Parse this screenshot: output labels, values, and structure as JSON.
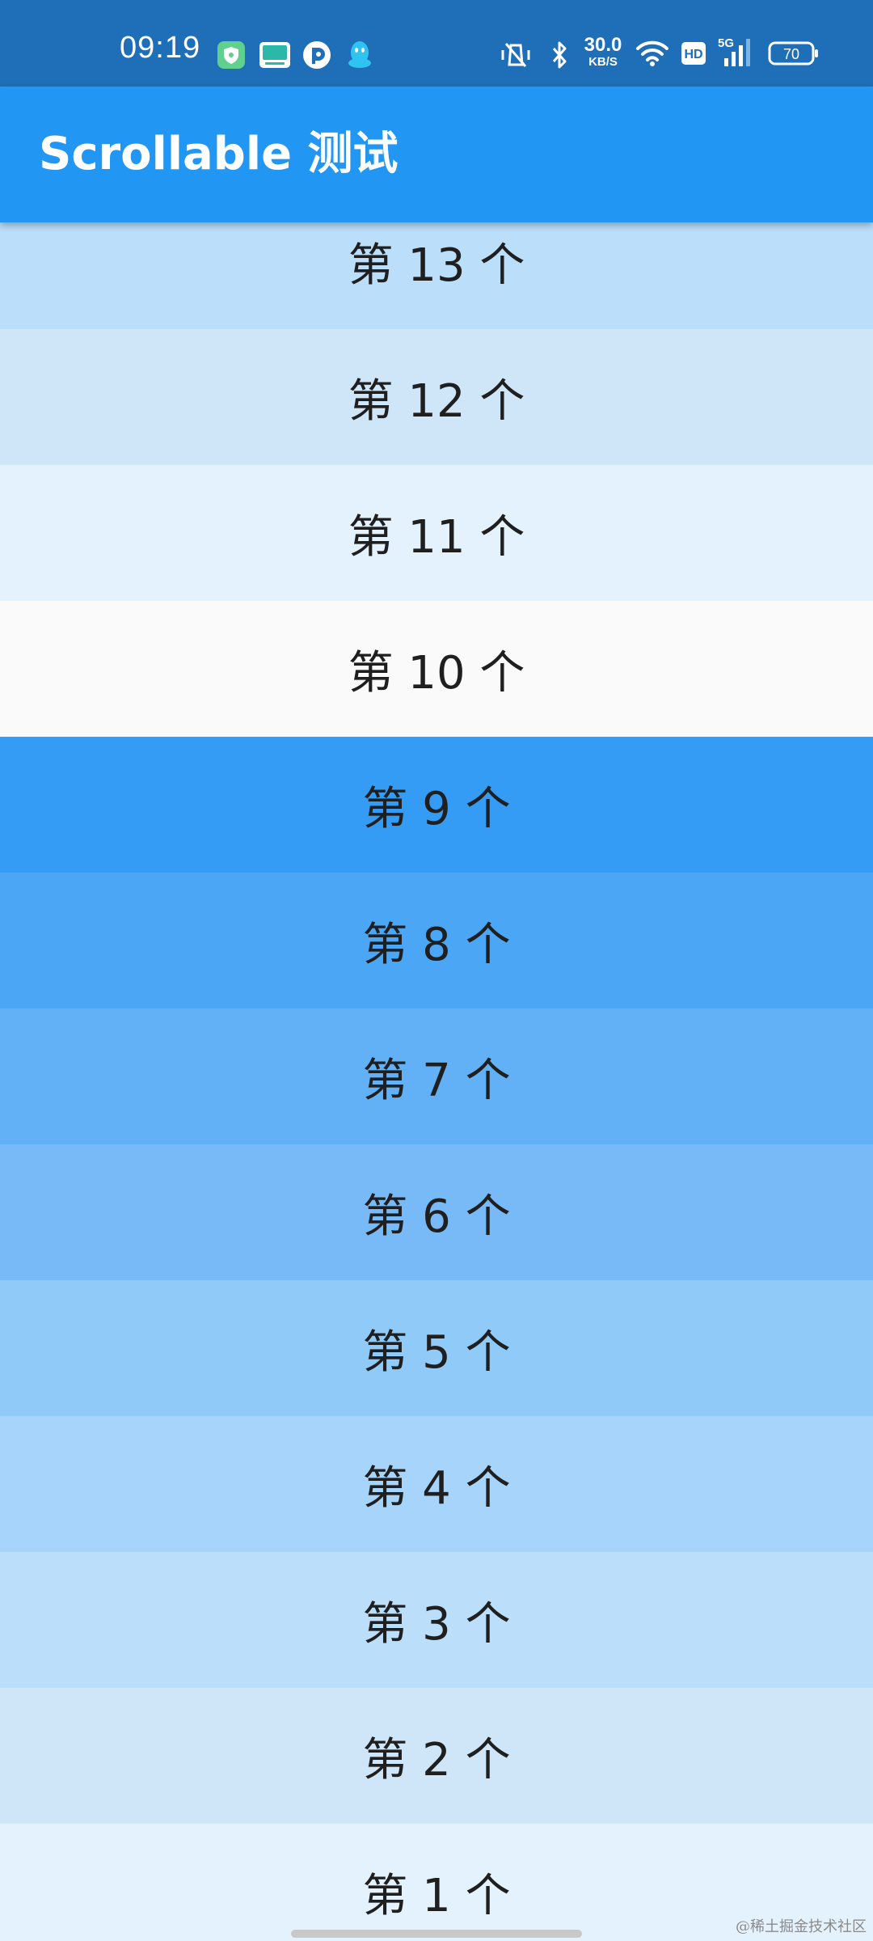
{
  "status_bar": {
    "time": "09:19",
    "speed_value": "30.0",
    "speed_unit": "KB/S",
    "hd_label": "HD",
    "network_label": "5G",
    "battery": "70"
  },
  "app_bar": {
    "title": "Scrollable 测试",
    "color": "#2196f3"
  },
  "list": {
    "items": [
      {
        "label": "第 13 个",
        "color": "#bbdefb"
      },
      {
        "label": "第 12 个",
        "color": "#cfe6f9"
      },
      {
        "label": "第 11 个",
        "color": "#e3f2fd"
      },
      {
        "label": "第 10 个",
        "color": "#fafafa"
      },
      {
        "label": "第 9 个",
        "color": "#349cf4"
      },
      {
        "label": "第 8 个",
        "color": "#4ba6f5"
      },
      {
        "label": "第 7 个",
        "color": "#62b0f6"
      },
      {
        "label": "第 6 个",
        "color": "#78baf7"
      },
      {
        "label": "第 5 个",
        "color": "#90caf9"
      },
      {
        "label": "第 4 个",
        "color": "#a6d4fa"
      },
      {
        "label": "第 3 个",
        "color": "#bbdefb"
      },
      {
        "label": "第 2 个",
        "color": "#cfe6f9"
      },
      {
        "label": "第 1 个",
        "color": "#e3f2fd"
      }
    ]
  },
  "watermark": "@稀土掘金技术社区"
}
